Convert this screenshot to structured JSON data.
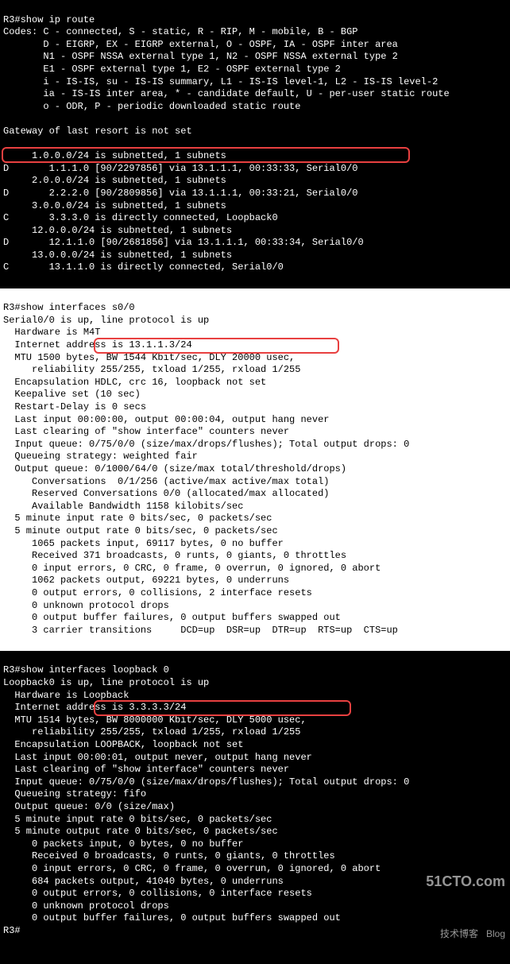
{
  "panel1": {
    "prompt": "R3#show ip route",
    "codes": "Codes: C - connected, S - static, R - RIP, M - mobile, B - BGP\n       D - EIGRP, EX - EIGRP external, O - OSPF, IA - OSPF inter area\n       N1 - OSPF NSSA external type 1, N2 - OSPF NSSA external type 2\n       E1 - OSPF external type 1, E2 - OSPF external type 2\n       i - IS-IS, su - IS-IS summary, L1 - IS-IS level-1, L2 - IS-IS level-2\n       ia - IS-IS inter area, * - candidate default, U - per-user static route\n       o - ODR, P - periodic downloaded static route",
    "gateway": "Gateway of last resort is not set",
    "routes": "     1.0.0.0/24 is subnetted, 1 subnets\nD       1.1.1.0 [90/2297856] via 13.1.1.1, 00:33:33, Serial0/0\n     2.0.0.0/24 is subnetted, 1 subnets\nD       2.2.2.0 [90/2809856] via 13.1.1.1, 00:33:21, Serial0/0\n     3.0.0.0/24 is subnetted, 1 subnets\nC       3.3.3.0 is directly connected, Loopback0\n     12.0.0.0/24 is subnetted, 1 subnets\nD       12.1.1.0 [90/2681856] via 13.1.1.1, 00:33:34, Serial0/0\n     13.0.0.0/24 is subnetted, 1 subnets\nC       13.1.1.0 is directly connected, Serial0/0"
  },
  "panel2": {
    "prompt": "R3#show interfaces s0/0",
    "body": "Serial0/0 is up, line protocol is up\n  Hardware is M4T\n  Internet address is 13.1.1.3/24\n  MTU 1500 bytes, BW 1544 Kbit/sec, DLY 20000 usec,\n     reliability 255/255, txload 1/255, rxload 1/255\n  Encapsulation HDLC, crc 16, loopback not set\n  Keepalive set (10 sec)\n  Restart-Delay is 0 secs\n  Last input 00:00:00, output 00:00:04, output hang never\n  Last clearing of \"show interface\" counters never\n  Input queue: 0/75/0/0 (size/max/drops/flushes); Total output drops: 0\n  Queueing strategy: weighted fair\n  Output queue: 0/1000/64/0 (size/max total/threshold/drops)\n     Conversations  0/1/256 (active/max active/max total)\n     Reserved Conversations 0/0 (allocated/max allocated)\n     Available Bandwidth 1158 kilobits/sec\n  5 minute input rate 0 bits/sec, 0 packets/sec\n  5 minute output rate 0 bits/sec, 0 packets/sec\n     1065 packets input, 69117 bytes, 0 no buffer\n     Received 371 broadcasts, 0 runts, 0 giants, 0 throttles\n     0 input errors, 0 CRC, 0 frame, 0 overrun, 0 ignored, 0 abort\n     1062 packets output, 69221 bytes, 0 underruns\n     0 output errors, 0 collisions, 2 interface resets\n     0 unknown protocol drops\n     0 output buffer failures, 0 output buffers swapped out\n     3 carrier transitions     DCD=up  DSR=up  DTR=up  RTS=up  CTS=up"
  },
  "panel3": {
    "prompt": "R3#show interfaces loopback 0",
    "body": "Loopback0 is up, line protocol is up\n  Hardware is Loopback\n  Internet address is 3.3.3.3/24\n  MTU 1514 bytes, BW 8000000 Kbit/sec, DLY 5000 usec,\n     reliability 255/255, txload 1/255, rxload 1/255\n  Encapsulation LOOPBACK, loopback not set\n  Last input 00:00:01, output never, output hang never\n  Last clearing of \"show interface\" counters never\n  Input queue: 0/75/0/0 (size/max/drops/flushes); Total output drops: 0\n  Queueing strategy: fifo\n  Output queue: 0/0 (size/max)\n  5 minute input rate 0 bits/sec, 0 packets/sec\n  5 minute output rate 0 bits/sec, 0 packets/sec\n     0 packets input, 0 bytes, 0 no buffer\n     Received 0 broadcasts, 0 runts, 0 giants, 0 throttles\n     0 input errors, 0 CRC, 0 frame, 0 overrun, 0 ignored, 0 abort\n     684 packets output, 41040 bytes, 0 underruns\n     0 output errors, 0 collisions, 0 interface resets\n     0 unknown protocol drops\n     0 output buffer failures, 0 output buffers swapped out",
    "endprompt": "R3#"
  },
  "watermark": {
    "main": "51CTO.com",
    "sub": "技术博客   Blog"
  }
}
